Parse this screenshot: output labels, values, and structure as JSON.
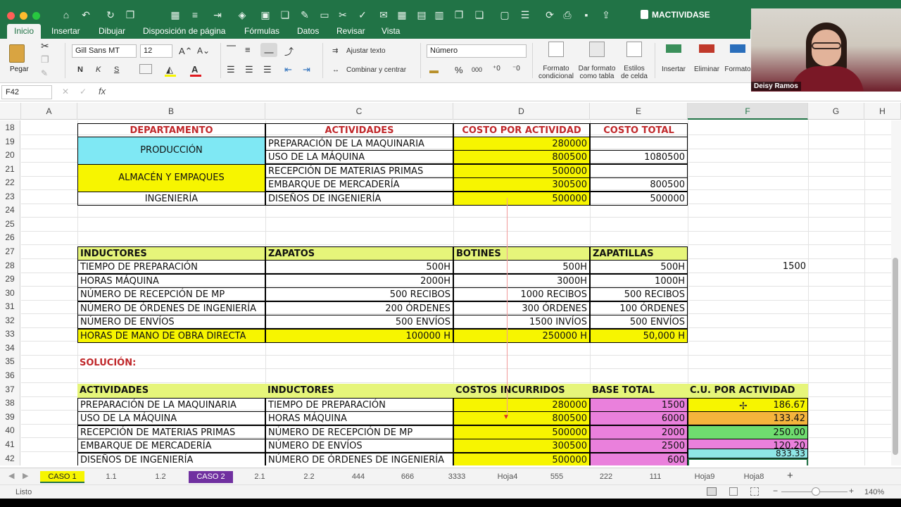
{
  "title_bar": {
    "doc_title": "MACTIVIDASE"
  },
  "ribbon_tabs": [
    "Inicio",
    "Insertar",
    "Dibujar",
    "Disposición de página",
    "Fórmulas",
    "Datos",
    "Revisar",
    "Vista"
  ],
  "ribbon": {
    "paste": "Pegar",
    "font_name": "Gill Sans MT",
    "font_size": "12",
    "bold": "N",
    "italic": "K",
    "underline": "S",
    "wrap_text": "Ajustar texto",
    "merge_center": "Combinar y centrar",
    "number_format": "Número",
    "percent": "%",
    "thousands": "000",
    "conditional_format": [
      "Formato",
      "condicional"
    ],
    "format_table": [
      "Dar formato",
      "como tabla"
    ],
    "cell_styles": [
      "Estilos",
      "de celda"
    ],
    "insert": "Insertar",
    "delete": "Eliminar",
    "format": "Formato"
  },
  "formula_bar": {
    "name_box": "F42",
    "fx": "fx",
    "cancel": "✕",
    "confirm": "✓"
  },
  "columns": [
    "A",
    "B",
    "C",
    "D",
    "E",
    "F",
    "G",
    "H"
  ],
  "rows": [
    "18",
    "19",
    "20",
    "21",
    "22",
    "23",
    "24",
    "25",
    "26",
    "27",
    "28",
    "29",
    "30",
    "31",
    "32",
    "33",
    "34",
    "35",
    "36",
    "37",
    "38",
    "39",
    "40",
    "41",
    "42"
  ],
  "table1": {
    "headers": [
      "DEPARTAMENTO",
      "ACTIVIDADES",
      "COSTO POR ACTIVIDAD",
      "COSTO TOTAL"
    ],
    "departments": [
      "PRODUCCIÓN",
      "ALMACÉN Y EMPAQUES",
      "INGENIERÍA"
    ],
    "rows": [
      {
        "activity": "PREPARACIÓN DE LA MAQUINARIA",
        "cost": "280000",
        "total": ""
      },
      {
        "activity": "USO DE LA MÁQUINA",
        "cost": "800500",
        "total": "1080500"
      },
      {
        "activity": "RECEPCIÓN DE MATERIAS PRIMAS",
        "cost": "500000",
        "total": ""
      },
      {
        "activity": "EMBARQUE DE MERCADERÍA",
        "cost": "300500",
        "total": "800500"
      },
      {
        "activity": "DISEÑOS DE INGENIERÍA",
        "cost": "500000",
        "total": "500000"
      }
    ]
  },
  "table2": {
    "headers": [
      "INDUCTORES",
      "ZAPATOS",
      "BOTINES",
      "ZAPATILLAS"
    ],
    "rows": [
      {
        "name": "TIEMPO DE PREPARACIÓN",
        "zapatos": "500H",
        "botines": "500H",
        "zapatillas": "500H"
      },
      {
        "name": "HORAS MÁQUINA",
        "zapatos": "2000H",
        "botines": "3000H",
        "zapatillas": "1000H"
      },
      {
        "name": "NÚMERO DE RECEPCIÓN DE MP",
        "zapatos": "500 RECIBOS",
        "botines": "1000 RECIBOS",
        "zapatillas": "500 RECIBOS"
      },
      {
        "name": "NÚMERO DE ÓRDENES DE INGENIERÍA",
        "zapatos": "200 ÓRDENES",
        "botines": "300 ÓRDENES",
        "zapatillas": "100 ÓRDENES"
      },
      {
        "name": "NÚMERO DE ENVÍOS",
        "zapatos": "500 ENVÍOS",
        "botines": "1500 INVÍOS",
        "zapatillas": "500 ENVÍOS"
      },
      {
        "name": "HORAS DE MANO DE OBRA DIRECTA",
        "zapatos": "100000 H",
        "botines": "250000 H",
        "zapatillas": "50,000 H"
      }
    ],
    "side_value": "1500"
  },
  "solution_label": "SOLUCIÓN:",
  "table3": {
    "headers": [
      "ACTIVIDADES",
      "INDUCTORES",
      "COSTOS INCURRIDOS",
      "BASE TOTAL",
      "C.U. POR ACTIVIDAD"
    ],
    "rows": [
      {
        "activity": "PREPARACIÓN DE LA MAQUINARIA",
        "driver": "TIEMPO DE PREPARACIÓN",
        "cost": "280000",
        "base": "1500",
        "unit": "186.67",
        "unit_color": "#f7f500"
      },
      {
        "activity": "USO DE LA MÁQUINA",
        "driver": "HORAS MÁQUINA",
        "cost": "800500",
        "base": "6000",
        "unit": "133.42",
        "unit_color": "#f5b43c"
      },
      {
        "activity": "RECEPCIÓN DE MATERIAS PRIMAS",
        "driver": "NÚMERO DE RECEPCIÓN DE MP",
        "cost": "500000",
        "base": "2000",
        "unit": "250.00",
        "unit_color": "#6fdc6f"
      },
      {
        "activity": "EMBARQUE DE MERCADERÍA",
        "driver": "NÚMERO DE ENVÍOS",
        "cost": "300500",
        "base": "2500",
        "unit": "120.20",
        "unit_color": "#ea80dc"
      },
      {
        "activity": "DISEÑOS DE INGENIERÍA",
        "driver": "NÚMERO DE ÓRDENES DE INGENIERÍA",
        "cost": "500000",
        "base": "600",
        "unit": "833.33",
        "unit_color": "#8fe6e6"
      }
    ]
  },
  "sheet_tabs": [
    "CASO 1",
    "1.1",
    "1.2",
    "CASO 2",
    "2.1",
    "2.2",
    "444",
    "666",
    "3333",
    "Hoja4",
    "555",
    "222",
    "111",
    "Hoja9",
    "Hoja8"
  ],
  "status": {
    "ready": "Listo",
    "zoom": "140%"
  },
  "webcam": {
    "name": "Deisy Ramos"
  },
  "colors": {
    "excel_green": "#217346",
    "yellow": "#f7f500",
    "cyan": "#7fe8f4",
    "pink": "#ea80dc",
    "purple_tab": "#7030a0",
    "header_red": "#c0282b"
  }
}
